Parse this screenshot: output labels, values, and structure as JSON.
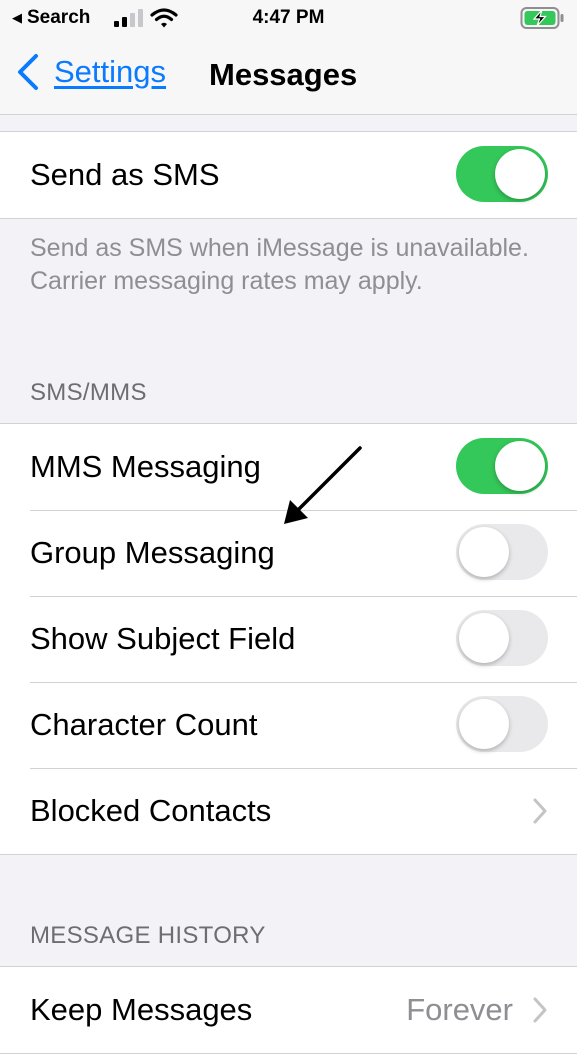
{
  "status_bar": {
    "back_app": "Search",
    "time": "4:47 PM",
    "icons": [
      "back-triangle-icon",
      "cellular-signal-icon",
      "wifi-icon",
      "battery-charging-icon"
    ]
  },
  "nav": {
    "back_label": "Settings",
    "title": "Messages"
  },
  "send_as_sms": {
    "label": "Send as SMS",
    "on": true,
    "footnote": "Send as SMS when iMessage is unavailable. Carrier messaging rates may apply."
  },
  "sms_mms": {
    "header": "SMS/MMS",
    "rows": [
      {
        "label": "MMS Messaging",
        "on": true
      },
      {
        "label": "Group Messaging",
        "on": false
      },
      {
        "label": "Show Subject Field",
        "on": false
      },
      {
        "label": "Character Count",
        "on": false
      },
      {
        "label": "Blocked Contacts"
      }
    ]
  },
  "message_history": {
    "header": "MESSAGE HISTORY",
    "rows": [
      {
        "label": "Keep Messages",
        "value": "Forever"
      }
    ]
  },
  "colors": {
    "toggle_on": "#34c759",
    "toggle_off": "#e9e9eb",
    "link": "#0a7aff",
    "annotation_arrow": "#000000"
  },
  "annotation": {
    "icon": "annotation-arrow-icon"
  }
}
